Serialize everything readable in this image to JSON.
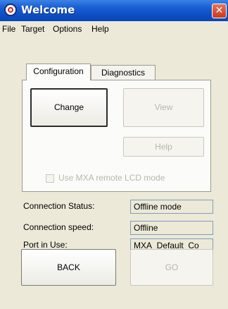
{
  "window": {
    "title": "Welcome",
    "icon": "app-logo-icon",
    "close_glyph": "✕"
  },
  "menu": {
    "items": [
      "File",
      "Target",
      "Options",
      "Help"
    ]
  },
  "tabs": [
    {
      "label": "Configuration",
      "selected": true
    },
    {
      "label": "Diagnostics",
      "selected": false
    }
  ],
  "configuration": {
    "change_label": "Change",
    "view_label": "View",
    "help_label": "Help",
    "remote_lcd_label": "Use MXA remote LCD mode",
    "remote_lcd_checked": false
  },
  "status": {
    "connection_status": {
      "label": "Connection Status:",
      "value": "Offline mode"
    },
    "connection_speed": {
      "label": "Connection speed:",
      "value": "Offline"
    },
    "port_in_use": {
      "label": "Port in Use:",
      "value": "MXA_Default_Co"
    }
  },
  "nav": {
    "back_label": "BACK",
    "go_label": "GO"
  },
  "colors": {
    "titlebar": "#0d4fc5",
    "window_bg": "#ece9d8",
    "close_button": "#c9391d",
    "disabled_text": "#b8b7ad"
  }
}
